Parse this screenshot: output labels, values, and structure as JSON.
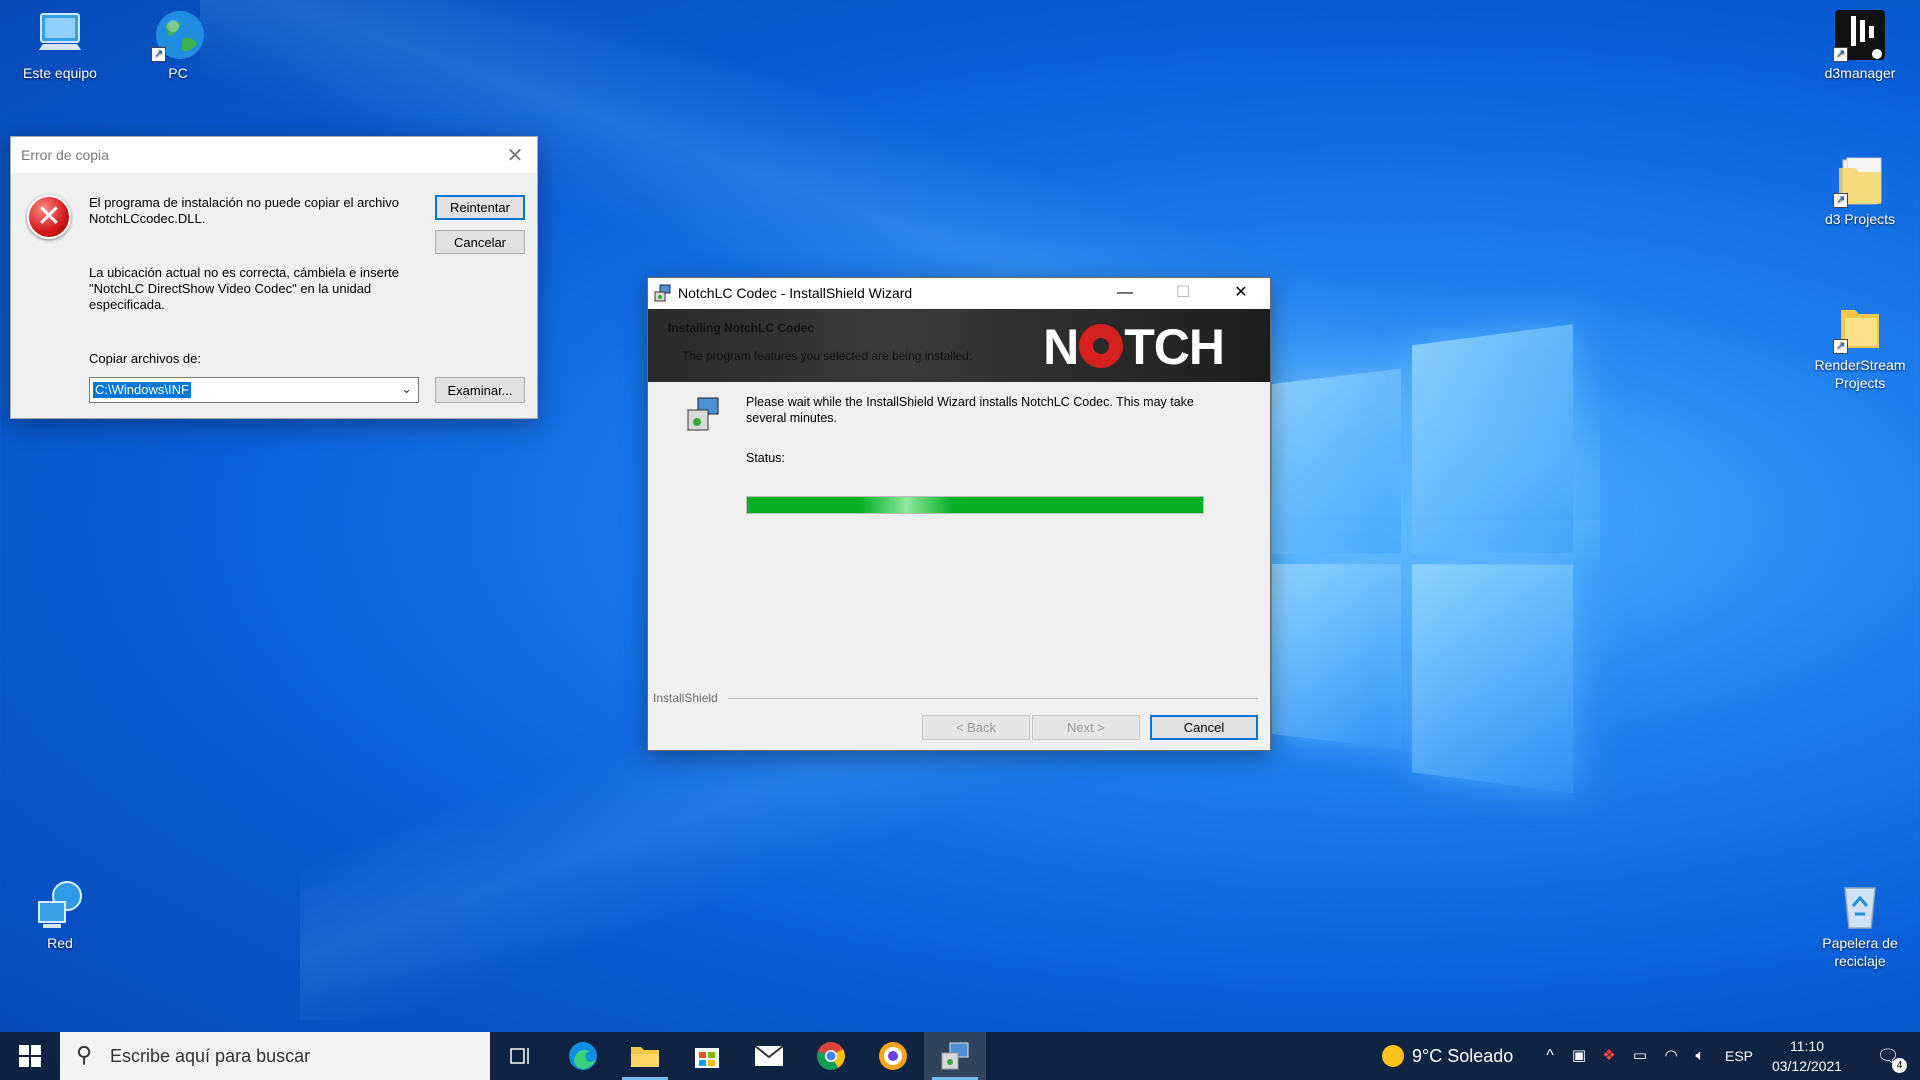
{
  "desktop": {
    "icons": [
      {
        "label": "Este equipo",
        "icon": "computer-icon"
      },
      {
        "label": "PC",
        "icon": "globe-icon"
      },
      {
        "label": "Red",
        "icon": "network-icon"
      },
      {
        "label": "d3manager",
        "icon": "d3-app-icon"
      },
      {
        "label": "d3 Projects",
        "icon": "folder-icon"
      },
      {
        "label": "RenderStream Projects",
        "icon": "folder-icon"
      },
      {
        "label": "Papelera de reciclaje",
        "icon": "recycle-bin-icon"
      }
    ]
  },
  "error_dialog": {
    "title": "Error de copia",
    "message1": "El programa de instalación no puede copiar el archivo NotchLCcodec.DLL.",
    "message2": "La ubicación actual no es correcta, cámbiela e inserte \"NotchLC DirectShow Video Codec\" en la unidad especificada.",
    "copy_label": "Copiar archivos de:",
    "path_value": "C:\\Windows\\INF",
    "retry_label": "Reintentar",
    "cancel_label": "Cancelar",
    "browse_label": "Examinar..."
  },
  "wizard": {
    "title": "NotchLC Codec - InstallShield Wizard",
    "banner_title": "Installing NotchLC Codec",
    "banner_subtitle": "The program features you selected are being installed.",
    "logo_left": "N",
    "logo_right": "TCH",
    "message": "Please wait while the InstallShield Wizard installs NotchLC Codec. This may take several minutes.",
    "status_label": "Status:",
    "progress": 1.0,
    "footer_brand": "InstallShield",
    "back_label": "< Back",
    "next_label": "Next >",
    "cancel_label": "Cancel"
  },
  "taskbar": {
    "search_placeholder": "Escribe aquí para buscar",
    "weather": "9°C Soleado",
    "language": "ESP",
    "time": "11:10",
    "date": "03/12/2021",
    "notification_count": "4"
  },
  "colors": {
    "accent": "#0078d7",
    "progress": "#06b025",
    "error": "#d21919",
    "notch_red": "#d52020"
  }
}
